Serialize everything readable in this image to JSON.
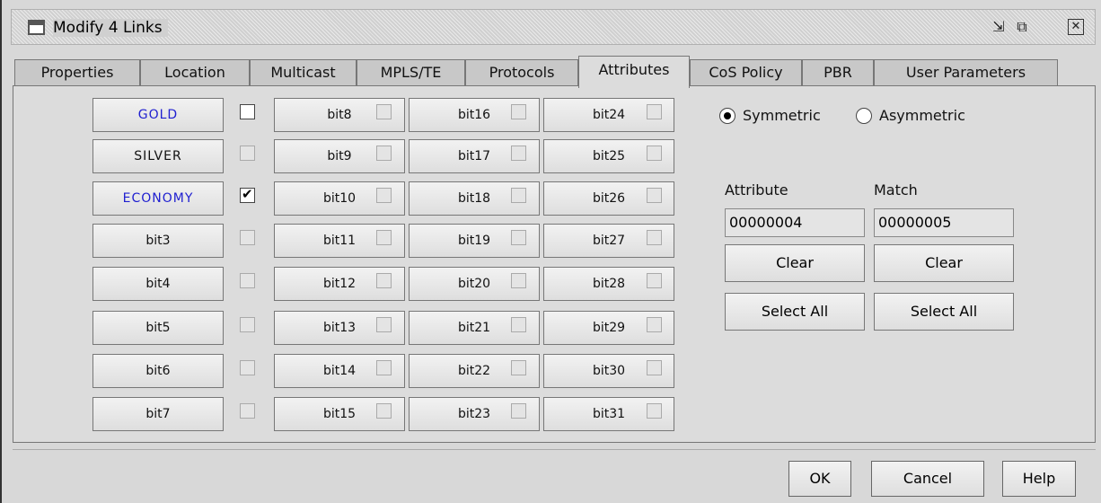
{
  "window": {
    "title": "Modify 4 Links",
    "restore_glyph": "⇲",
    "maximize_glyph": "⧉",
    "close_glyph": "✕"
  },
  "tabs": [
    {
      "label": "Properties",
      "active": false
    },
    {
      "label": "Location",
      "active": false
    },
    {
      "label": "Multicast",
      "active": false
    },
    {
      "label": "MPLS/TE",
      "active": false
    },
    {
      "label": "Protocols",
      "active": false
    },
    {
      "label": "Attributes",
      "active": true
    },
    {
      "label": "CoS Policy",
      "active": false
    },
    {
      "label": "PBR",
      "active": false
    },
    {
      "label": "User Parameters",
      "active": false
    }
  ],
  "bits": [
    {
      "label": "GOLD",
      "checked": false,
      "enabled": true
    },
    {
      "label": "SILVER",
      "checked": false,
      "enabled": false
    },
    {
      "label": "ECONOMY",
      "checked": true,
      "enabled": true
    },
    {
      "label": "bit3",
      "checked": false,
      "enabled": false
    },
    {
      "label": "bit4",
      "checked": false,
      "enabled": false
    },
    {
      "label": "bit5",
      "checked": false,
      "enabled": false
    },
    {
      "label": "bit6",
      "checked": false,
      "enabled": false
    },
    {
      "label": "bit7",
      "checked": false,
      "enabled": false
    },
    {
      "label": "bit8",
      "checked": false,
      "enabled": false
    },
    {
      "label": "bit9",
      "checked": false,
      "enabled": false
    },
    {
      "label": "bit10",
      "checked": false,
      "enabled": false
    },
    {
      "label": "bit11",
      "checked": false,
      "enabled": false
    },
    {
      "label": "bit12",
      "checked": false,
      "enabled": false
    },
    {
      "label": "bit13",
      "checked": false,
      "enabled": false
    },
    {
      "label": "bit14",
      "checked": false,
      "enabled": false
    },
    {
      "label": "bit15",
      "checked": false,
      "enabled": false
    },
    {
      "label": "bit16",
      "checked": false,
      "enabled": false
    },
    {
      "label": "bit17",
      "checked": false,
      "enabled": false
    },
    {
      "label": "bit18",
      "checked": false,
      "enabled": false
    },
    {
      "label": "bit19",
      "checked": false,
      "enabled": false
    },
    {
      "label": "bit20",
      "checked": false,
      "enabled": false
    },
    {
      "label": "bit21",
      "checked": false,
      "enabled": false
    },
    {
      "label": "bit22",
      "checked": false,
      "enabled": false
    },
    {
      "label": "bit23",
      "checked": false,
      "enabled": false
    },
    {
      "label": "bit24",
      "checked": false,
      "enabled": false
    },
    {
      "label": "bit25",
      "checked": false,
      "enabled": false
    },
    {
      "label": "bit26",
      "checked": false,
      "enabled": false
    },
    {
      "label": "bit27",
      "checked": false,
      "enabled": false
    },
    {
      "label": "bit28",
      "checked": false,
      "enabled": false
    },
    {
      "label": "bit29",
      "checked": false,
      "enabled": false
    },
    {
      "label": "bit30",
      "checked": false,
      "enabled": false
    },
    {
      "label": "bit31",
      "checked": false,
      "enabled": false
    }
  ],
  "symmetry": {
    "symmetric_label": "Symmetric",
    "asymmetric_label": "Asymmetric",
    "selected": "symmetric"
  },
  "attribute": {
    "label": "Attribute",
    "value": "00000004",
    "clear_label": "Clear",
    "select_all_label": "Select All"
  },
  "match": {
    "label": "Match",
    "value": "00000005",
    "clear_label": "Clear",
    "select_all_label": "Select All"
  },
  "footer": {
    "ok_label": "OK",
    "cancel_label": "Cancel",
    "help_label": "Help"
  },
  "colors": {
    "named_bit_color": "#2020d0",
    "panel_bg": "#dcdcdc"
  }
}
